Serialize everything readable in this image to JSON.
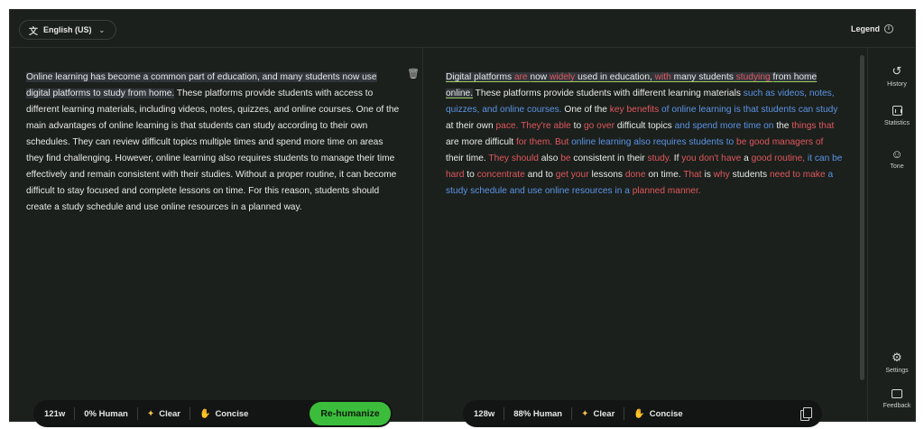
{
  "topbar": {
    "language": "English (US)",
    "legend_label": "Legend"
  },
  "left": {
    "text_highlighted": "Online learning has become a common part of education, and many students now use digital platforms to study from home.",
    "text_rest": " These platforms provide students with access to different learning materials, including videos, notes, quizzes, and online courses. One of the main advantages of online learning is that students can study according to their own schedules. They can review difficult topics multiple times and spend more time on areas they find challenging. However, online learning also requires students to manage their time effectively and remain consistent with their studies. Without a proper routine, it can become difficult to stay focused and complete lessons on time. For this reason, students should create a study schedule and use online resources in a planned way.",
    "word_count": "121w",
    "human_score": "0% Human",
    "clear_label": "Clear",
    "concise_label": "Concise",
    "rehumanize_label": "Re-humanize"
  },
  "right": {
    "segments": [
      {
        "t": "Digital platforms",
        "c": "w",
        "hl": true
      },
      {
        "t": " are ",
        "c": "r",
        "hl": true
      },
      {
        "t": "now",
        "c": "w",
        "hl": true
      },
      {
        "t": " widely ",
        "c": "r",
        "hl": true
      },
      {
        "t": "used in education,",
        "c": "w",
        "hl": true
      },
      {
        "t": " with ",
        "c": "r",
        "hl": true
      },
      {
        "t": "many students",
        "c": "w",
        "hl": true
      },
      {
        "t": " studying ",
        "c": "r",
        "hl": true
      },
      {
        "t": "from home online.",
        "c": "w",
        "hl": true
      },
      {
        "t": " These platforms provide students with different learning materials",
        "c": "w"
      },
      {
        "t": " such as videos, notes, quizzes, and online courses.",
        "c": "b"
      },
      {
        "t": " One of the",
        "c": "w"
      },
      {
        "t": " key benefits ",
        "c": "r"
      },
      {
        "t": "of online learning is that students can study",
        "c": "b"
      },
      {
        "t": " at their own",
        "c": "w"
      },
      {
        "t": " pace. They're able ",
        "c": "r"
      },
      {
        "t": "to",
        "c": "w"
      },
      {
        "t": " go over ",
        "c": "r"
      },
      {
        "t": "difficult topics",
        "c": "w"
      },
      {
        "t": " and spend more time on",
        "c": "b"
      },
      {
        "t": " the",
        "c": "w"
      },
      {
        "t": " things that ",
        "c": "r"
      },
      {
        "t": "are more difficult",
        "c": "w"
      },
      {
        "t": " for them. But ",
        "c": "r"
      },
      {
        "t": "online learning also requires students to",
        "c": "b"
      },
      {
        "t": " be good managers of ",
        "c": "r"
      },
      {
        "t": "their time.",
        "c": "w"
      },
      {
        "t": " They should ",
        "c": "r"
      },
      {
        "t": "also",
        "c": "w"
      },
      {
        "t": " be ",
        "c": "r"
      },
      {
        "t": "consistent in their",
        "c": "w"
      },
      {
        "t": " study.",
        "c": "r"
      },
      {
        "t": " If",
        "c": "w"
      },
      {
        "t": " you don't have ",
        "c": "r"
      },
      {
        "t": "a",
        "c": "w"
      },
      {
        "t": " good routine, ",
        "c": "r"
      },
      {
        "t": "it can be",
        "c": "b"
      },
      {
        "t": " hard ",
        "c": "r"
      },
      {
        "t": "to",
        "c": "w"
      },
      {
        "t": " concentrate ",
        "c": "r"
      },
      {
        "t": "and to",
        "c": "w"
      },
      {
        "t": " get your ",
        "c": "r"
      },
      {
        "t": "lessons",
        "c": "w"
      },
      {
        "t": " done ",
        "c": "r"
      },
      {
        "t": "on time.",
        "c": "w"
      },
      {
        "t": " That ",
        "c": "r"
      },
      {
        "t": "is",
        "c": "w"
      },
      {
        "t": " why ",
        "c": "r"
      },
      {
        "t": "students",
        "c": "w"
      },
      {
        "t": " need to make ",
        "c": "r"
      },
      {
        "t": "a study schedule and use online resources in a",
        "c": "b"
      },
      {
        "t": " planned manner.",
        "c": "r"
      }
    ],
    "word_count": "128w",
    "human_score": "88% Human",
    "clear_label": "Clear",
    "concise_label": "Concise"
  },
  "sidebar": {
    "history": "History",
    "statistics": "Statistics",
    "tone": "Tone",
    "settings": "Settings",
    "feedback": "Feedback"
  },
  "colors": {
    "background": "#1b201c",
    "removed_red": "#e0575f",
    "changed_blue": "#5c93e6",
    "accent_green": "#3bbd3b"
  }
}
